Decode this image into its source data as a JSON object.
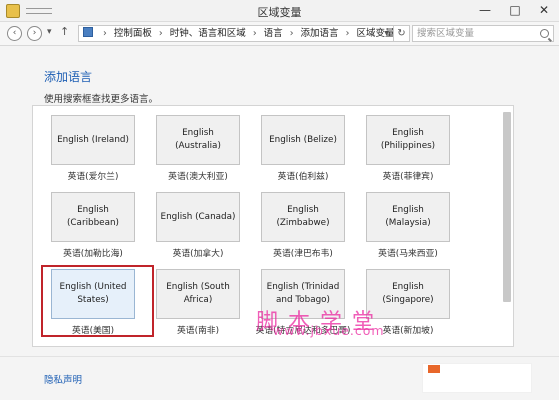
{
  "window": {
    "title": "区域变量",
    "minimize": "—",
    "maximize": "□",
    "close": "✕"
  },
  "nav": {
    "back": "‹",
    "forward": "›",
    "recent": "▾",
    "up": "↑",
    "breadcrumb": [
      "控制面板",
      "时钟、语言和区域",
      "语言",
      "添加语言",
      "区域变量"
    ],
    "separator": "›",
    "dropdown": "▾",
    "refresh": "↻",
    "search_placeholder": "搜索区域变量"
  },
  "page": {
    "title": "添加语言",
    "hint": "使用搜索框查找更多语言。"
  },
  "languages": [
    {
      "label": "English (Ireland)",
      "caption": "英语(爱尔兰)"
    },
    {
      "label": "English (Australia)",
      "caption": "英语(澳大利亚)"
    },
    {
      "label": "English (Belize)",
      "caption": "英语(伯利兹)"
    },
    {
      "label": "English (Philippines)",
      "caption": "英语(菲律宾)"
    },
    {
      "label": "English (Caribbean)",
      "caption": "英语(加勒比海)"
    },
    {
      "label": "English (Canada)",
      "caption": "英语(加拿大)"
    },
    {
      "label": "English (Zimbabwe)",
      "caption": "英语(津巴布韦)"
    },
    {
      "label": "English (Malaysia)",
      "caption": "英语(马来西亚)"
    },
    {
      "label": "English (United States)",
      "caption": "英语(美国)"
    },
    {
      "label": "English (South Africa)",
      "caption": "英语(南非)"
    },
    {
      "label": "English (Trinidad and Tobago)",
      "caption": "英语(特立尼达和多巴哥)"
    },
    {
      "label": "English (Singapore)",
      "caption": "英语(新加坡)"
    }
  ],
  "selected_index": 8,
  "watermark": {
    "text": "脚本学堂",
    "url": "www.jbxue.com"
  },
  "footer": {
    "privacy": "隐私声明"
  },
  "colors": {
    "link": "#1e5fb4",
    "selection_border": "#c0242a",
    "watermark": "#eb28a0"
  }
}
